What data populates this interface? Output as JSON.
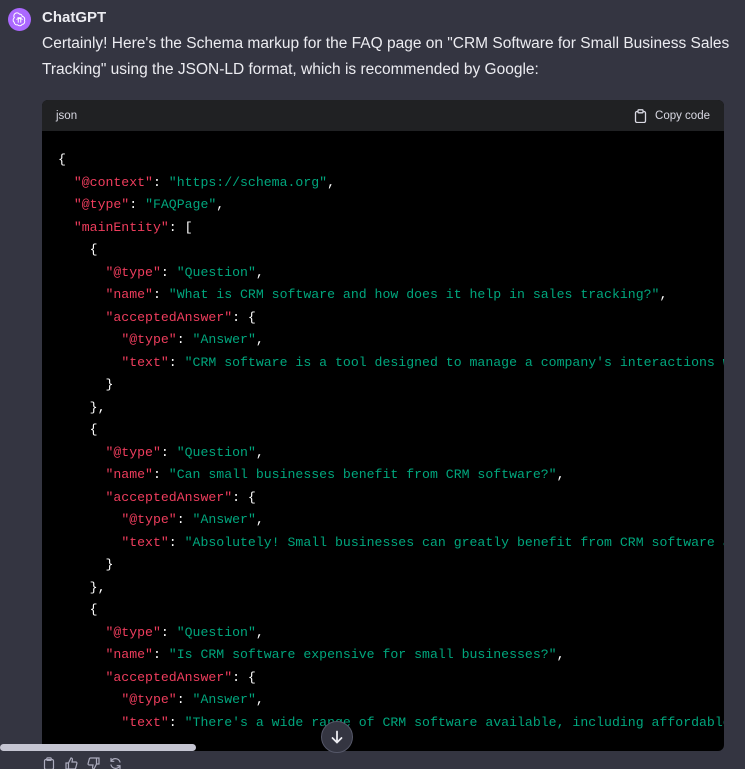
{
  "message": {
    "author": "ChatGPT",
    "intro": "Certainly! Here's the Schema markup for the FAQ page on \"CRM Software for Small Business Sales Tracking\" using the JSON-LD format, which is recommended by Google:"
  },
  "code_block": {
    "language": "json",
    "copy_label": "Copy code",
    "lines": [
      "{",
      "  \"@context\": \"https://schema.org\",",
      "  \"@type\": \"FAQPage\",",
      "  \"mainEntity\": [",
      "    {",
      "      \"@type\": \"Question\",",
      "      \"name\": \"What is CRM software and how does it help in sales tracking?\",",
      "      \"acceptedAnswer\": {",
      "        \"@type\": \"Answer\",",
      "        \"text\": \"CRM software is a tool designed to manage a company's interactions w",
      "      }",
      "    },",
      "    {",
      "      \"@type\": \"Question\",",
      "      \"name\": \"Can small businesses benefit from CRM software?\",",
      "      \"acceptedAnswer\": {",
      "        \"@type\": \"Answer\",",
      "        \"text\": \"Absolutely! Small businesses can greatly benefit from CRM software a",
      "      }",
      "    },",
      "    {",
      "      \"@type\": \"Question\",",
      "      \"name\": \"Is CRM software expensive for small businesses?\",",
      "      \"acceptedAnswer\": {",
      "        \"@type\": \"Answer\",",
      "        \"text\": \"There's a wide range of CRM software available, including affordable"
    ]
  },
  "colors": {
    "background": "#343541",
    "code_bg": "#000000",
    "code_header_bg": "#202123",
    "key": "#ef3d5d",
    "string": "#00a67d",
    "avatar": "#ab68ff"
  },
  "icons": {
    "avatar": "openai-logo-icon",
    "copy": "clipboard-icon",
    "scroll_down": "arrow-down-icon",
    "actions": [
      "clipboard-icon",
      "thumbs-up-icon",
      "thumbs-down-icon",
      "regenerate-icon"
    ]
  }
}
